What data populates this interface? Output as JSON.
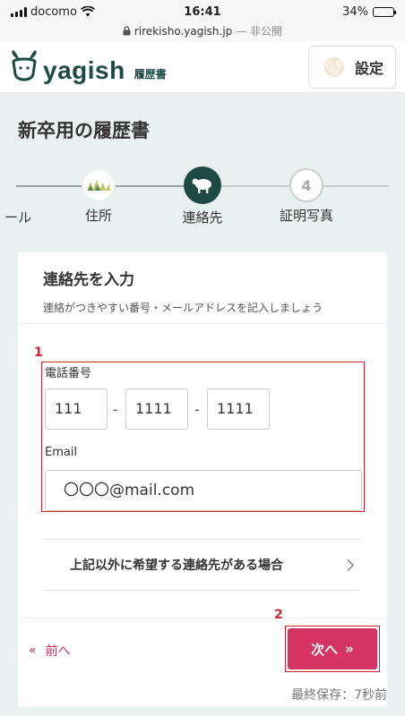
{
  "status": {
    "carrier": "docomo",
    "time": "16:41",
    "battery": "34%",
    "battery_level": 0.34
  },
  "browser": {
    "url": "rirekisho.yagish.jp",
    "security": "— 非公開"
  },
  "header": {
    "brand": "yagish",
    "subtitle": "履歴書",
    "settings_label": "設定"
  },
  "page": {
    "title": "新卒用の履歴書"
  },
  "stepper": {
    "steps": [
      {
        "label": "ール",
        "state": "past"
      },
      {
        "label": "住所",
        "state": "past"
      },
      {
        "label": "連絡先",
        "state": "current"
      },
      {
        "label": "証明写真",
        "number": "4",
        "state": "future"
      }
    ]
  },
  "card": {
    "title": "連絡先を入力",
    "description": "連絡がつきやすい番号・メールアドレスを記入しましょう",
    "phone_label": "電話番号",
    "phone": [
      "111",
      "1111",
      "1111"
    ],
    "separator": "-",
    "email_label": "Email",
    "email_value": "〇〇〇@mail.com",
    "other_contact_label": "上記以外に希望する連絡先がある場合"
  },
  "nav": {
    "prev_label": "前へ",
    "next_label": "次へ",
    "prev_icon": "«",
    "next_icon": "»"
  },
  "annotations": {
    "marker1": "1",
    "marker2": "2"
  },
  "footer": {
    "saved": "最終保存：7秒前"
  },
  "colors": {
    "accent": "#d63462",
    "brand": "#1b4b44",
    "highlight": "#d2202f",
    "background": "#e8f1ef"
  }
}
